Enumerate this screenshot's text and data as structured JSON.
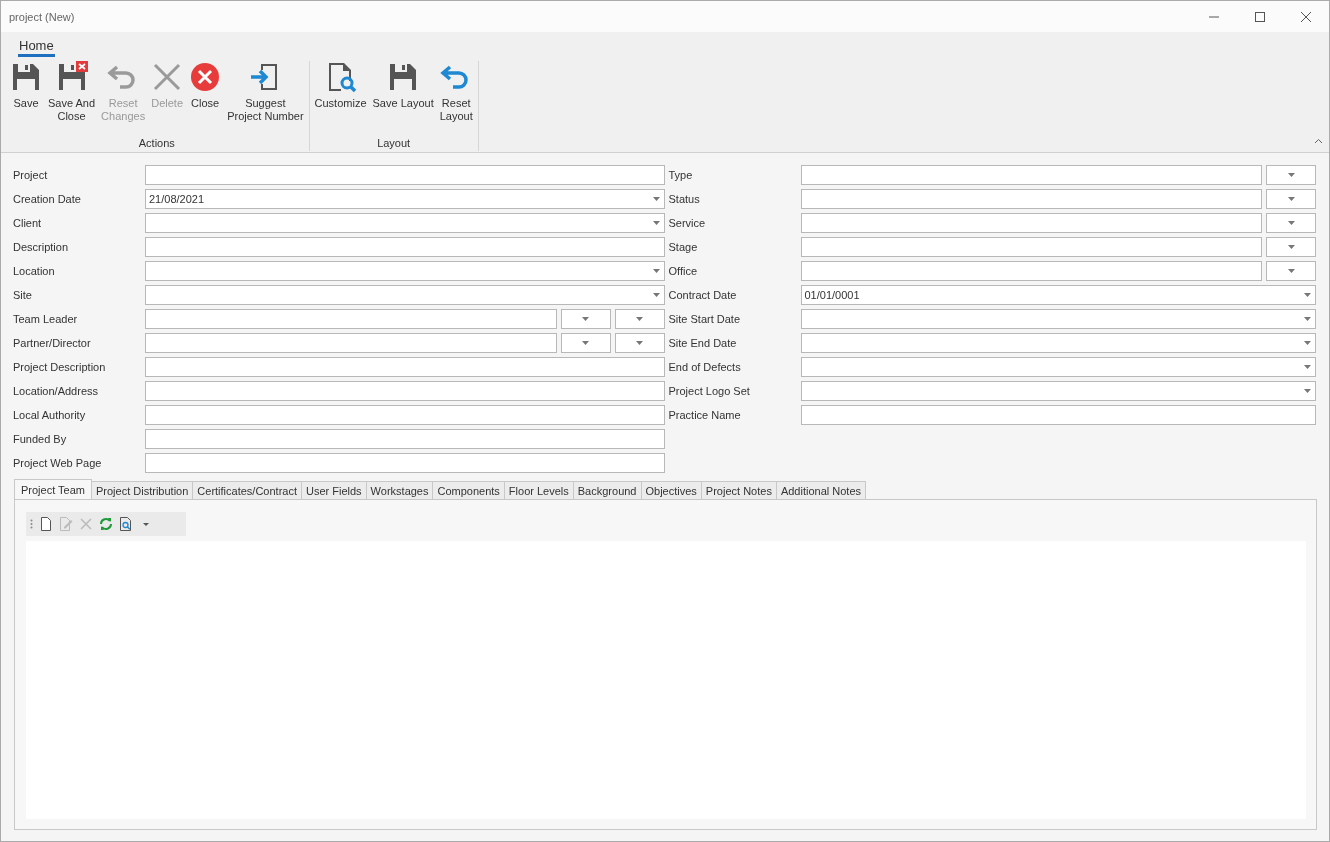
{
  "window": {
    "title": "project (New)"
  },
  "ribbon": {
    "tabs": [
      {
        "label": "Home",
        "selected": true
      }
    ],
    "groups": [
      {
        "label": "Actions",
        "buttons": [
          {
            "label": "Save",
            "disabled": false
          },
          {
            "label": "Save And\nClose",
            "disabled": false
          },
          {
            "label": "Reset\nChanges",
            "disabled": true
          },
          {
            "label": "Delete",
            "disabled": true
          },
          {
            "label": "Close",
            "disabled": false
          },
          {
            "label": "Suggest\nProject Number",
            "disabled": false
          }
        ]
      },
      {
        "label": "Layout",
        "buttons": [
          {
            "label": "Customize",
            "disabled": false
          },
          {
            "label": "Save Layout",
            "disabled": false
          },
          {
            "label": "Reset\nLayout",
            "disabled": false
          }
        ]
      }
    ]
  },
  "form": {
    "left": [
      {
        "label": "Project",
        "kind": "plain"
      },
      {
        "label": "Creation Date",
        "kind": "combo",
        "value": "21/08/2021"
      },
      {
        "label": "Client",
        "kind": "combo"
      },
      {
        "label": "Description",
        "kind": "plain"
      },
      {
        "label": "Location",
        "kind": "combo"
      },
      {
        "label": "Site",
        "kind": "combo"
      },
      {
        "label": "Team Leader",
        "kind": "pair"
      },
      {
        "label": "Partner/Director",
        "kind": "pair"
      },
      {
        "label": "Project Description",
        "kind": "plain"
      },
      {
        "label": "Location/Address",
        "kind": "plain"
      },
      {
        "label": "Local Authority",
        "kind": "plain"
      },
      {
        "label": "Funded By",
        "kind": "plain"
      },
      {
        "label": "Project Web Page",
        "kind": "plain"
      }
    ],
    "right": [
      {
        "label": "Type",
        "kind": "single"
      },
      {
        "label": "Status",
        "kind": "single"
      },
      {
        "label": "Service",
        "kind": "single"
      },
      {
        "label": "Stage",
        "kind": "single"
      },
      {
        "label": "Office",
        "kind": "single"
      },
      {
        "label": "Contract Date",
        "kind": "combo",
        "value": "01/01/0001"
      },
      {
        "label": "Site Start Date",
        "kind": "combo"
      },
      {
        "label": "Site End Date",
        "kind": "combo"
      },
      {
        "label": "End of Defects",
        "kind": "combo"
      },
      {
        "label": "Project Logo Set",
        "kind": "combo"
      },
      {
        "label": "Practice Name",
        "kind": "plain"
      }
    ]
  },
  "tabs": [
    {
      "label": "Project Team",
      "selected": true
    },
    {
      "label": "Project Distribution",
      "selected": false
    },
    {
      "label": "Certificates/Contract",
      "selected": false
    },
    {
      "label": "User Fields",
      "selected": false
    },
    {
      "label": "Workstages",
      "selected": false
    },
    {
      "label": "Components",
      "selected": false
    },
    {
      "label": "Floor Levels",
      "selected": false
    },
    {
      "label": "Background",
      "selected": false
    },
    {
      "label": "Objectives",
      "selected": false
    },
    {
      "label": "Project Notes",
      "selected": false
    },
    {
      "label": "Additional Notes",
      "selected": false
    }
  ],
  "grid_toolbar": [
    {
      "disabled": false
    },
    {
      "disabled": true
    },
    {
      "disabled": true
    },
    {
      "disabled": false
    },
    {
      "disabled": false
    },
    {
      "disabled": false
    }
  ]
}
